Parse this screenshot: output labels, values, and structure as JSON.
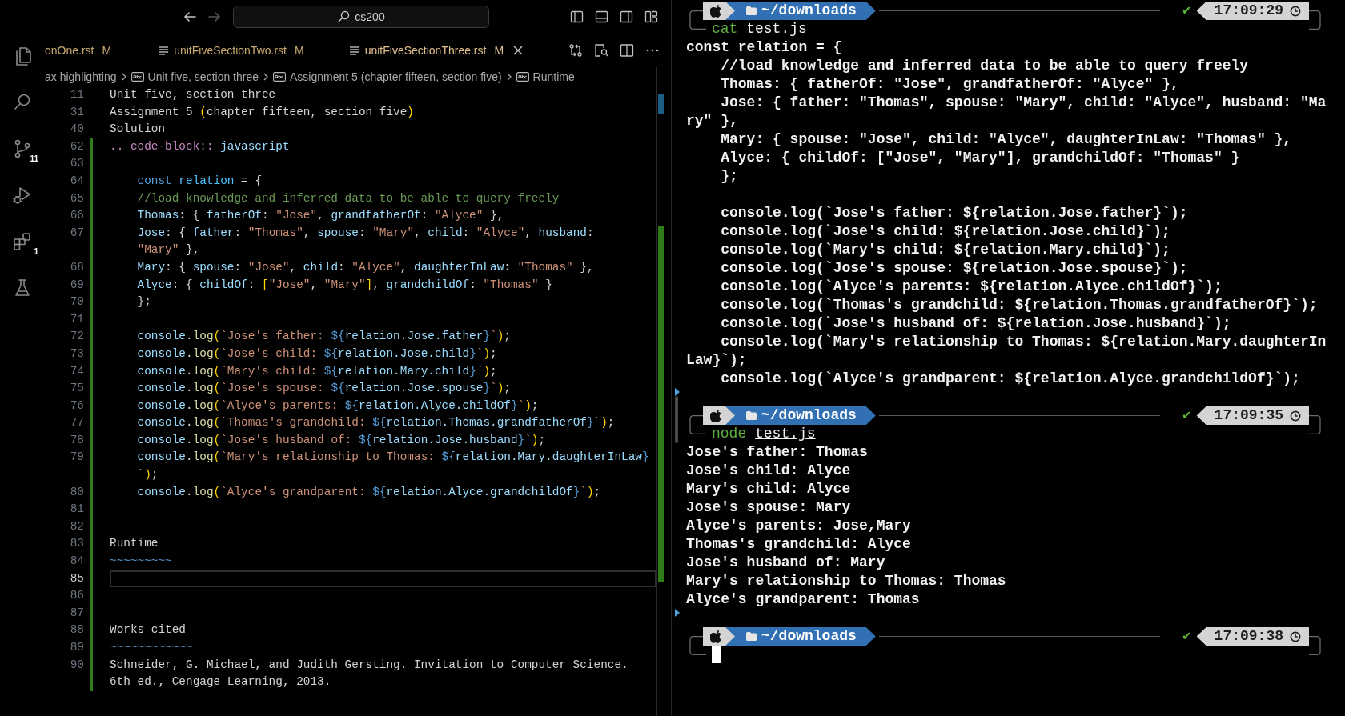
{
  "titlebar": {
    "back_disabled": false,
    "forward_disabled": true,
    "search": "cs200"
  },
  "activity_bar": [
    {
      "kind": "explorer"
    },
    {
      "kind": "search"
    },
    {
      "kind": "scm",
      "badge": "11"
    },
    {
      "kind": "debug"
    },
    {
      "kind": "extensions",
      "badge": "1"
    },
    {
      "kind": "testing"
    }
  ],
  "tabs": [
    {
      "label": "onOne.rst",
      "status": "M",
      "icon": false,
      "selected": false
    },
    {
      "label": "unitFiveSectionTwo.rst",
      "status": "M",
      "icon": true,
      "selected": false
    },
    {
      "label": "unitFiveSectionThree.rst",
      "status": "M",
      "icon": true,
      "selected": true
    }
  ],
  "breadcrumbs": [
    {
      "label": "ax highlighting",
      "icon": false
    },
    {
      "label": "Unit five, section three",
      "icon": true
    },
    {
      "label": "Assignment 5 (chapter fifteen, section five)",
      "icon": true
    },
    {
      "label": "Runtime",
      "icon": true
    }
  ],
  "editor": {
    "sticky": [
      {
        "number": "11",
        "tokens": [
          {
            "kind": "plain",
            "text": "Unit five, section three"
          }
        ]
      },
      {
        "number": "31",
        "tokens": [
          {
            "kind": "plain",
            "text": "Assignment 5 "
          },
          {
            "kind": "bracket",
            "text": "("
          },
          {
            "kind": "plain",
            "text": "chapter fifteen, section five"
          },
          {
            "kind": "bracket",
            "text": ")"
          }
        ]
      },
      {
        "number": "40",
        "tokens": [
          {
            "kind": "plain",
            "text": "Solution"
          }
        ]
      }
    ],
    "lines": [
      {
        "number": "62",
        "current": false,
        "tokens": [
          {
            "kind": "dir",
            "text": ".. code-block::"
          },
          {
            "kind": "var",
            "text": " javascript"
          }
        ]
      },
      {
        "number": "63",
        "current": false
      },
      {
        "number": "64",
        "current": false,
        "tokens": [
          {
            "kind": "kw",
            "text": "    const"
          },
          {
            "kind": "const",
            "text": " relation"
          },
          {
            "kind": "plain",
            "text": " = {"
          }
        ]
      },
      {
        "number": "65",
        "current": false,
        "tokens": [
          {
            "kind": "com",
            "text": "    //load knowledge and inferred data to be able to query freely"
          }
        ]
      },
      {
        "number": "66",
        "current": false,
        "tokens": [
          {
            "kind": "var",
            "text": "    Thomas"
          },
          {
            "kind": "plain",
            "text": ": { "
          },
          {
            "kind": "var",
            "text": "fatherOf"
          },
          {
            "kind": "plain",
            "text": ": "
          },
          {
            "kind": "str",
            "text": "\"Jose\""
          },
          {
            "kind": "plain",
            "text": ", "
          },
          {
            "kind": "var",
            "text": "grandfatherOf"
          },
          {
            "kind": "plain",
            "text": ": "
          },
          {
            "kind": "str",
            "text": "\"Alyce\""
          },
          {
            "kind": "plain",
            "text": " },"
          }
        ]
      },
      {
        "number": "67",
        "current": false,
        "tokens": [
          {
            "kind": "var",
            "text": "    Jose"
          },
          {
            "kind": "plain",
            "text": ": { "
          },
          {
            "kind": "var",
            "text": "father"
          },
          {
            "kind": "plain",
            "text": ": "
          },
          {
            "kind": "str",
            "text": "\"Thomas\""
          },
          {
            "kind": "plain",
            "text": ", "
          },
          {
            "kind": "var",
            "text": "spouse"
          },
          {
            "kind": "plain",
            "text": ": "
          },
          {
            "kind": "str",
            "text": "\"Mary\""
          },
          {
            "kind": "plain",
            "text": ", "
          },
          {
            "kind": "var",
            "text": "child"
          },
          {
            "kind": "plain",
            "text": ": "
          },
          {
            "kind": "str",
            "text": "\"Alyce\""
          },
          {
            "kind": "plain",
            "text": ", "
          },
          {
            "kind": "var",
            "text": "husband"
          },
          {
            "kind": "plain",
            "text": ":"
          }
        ]
      },
      {
        "current": false,
        "tokens": [
          {
            "kind": "str",
            "text": "    \"Mary\""
          },
          {
            "kind": "plain",
            "text": " },"
          }
        ]
      },
      {
        "number": "68",
        "current": false,
        "tokens": [
          {
            "kind": "var",
            "text": "    Mary"
          },
          {
            "kind": "plain",
            "text": ": { "
          },
          {
            "kind": "var",
            "text": "spouse"
          },
          {
            "kind": "plain",
            "text": ": "
          },
          {
            "kind": "str",
            "text": "\"Jose\""
          },
          {
            "kind": "plain",
            "text": ", "
          },
          {
            "kind": "var",
            "text": "child"
          },
          {
            "kind": "plain",
            "text": ": "
          },
          {
            "kind": "str",
            "text": "\"Alyce\""
          },
          {
            "kind": "plain",
            "text": ", "
          },
          {
            "kind": "var",
            "text": "daughterInLaw"
          },
          {
            "kind": "plain",
            "text": ": "
          },
          {
            "kind": "str",
            "text": "\"Thomas\""
          },
          {
            "kind": "plain",
            "text": " },"
          }
        ]
      },
      {
        "number": "69",
        "current": false,
        "tokens": [
          {
            "kind": "var",
            "text": "    Alyce"
          },
          {
            "kind": "plain",
            "text": ": { "
          },
          {
            "kind": "var",
            "text": "childOf"
          },
          {
            "kind": "plain",
            "text": ": "
          },
          {
            "kind": "bracket",
            "text": "["
          },
          {
            "kind": "str",
            "text": "\"Jose\""
          },
          {
            "kind": "plain",
            "text": ", "
          },
          {
            "kind": "str",
            "text": "\"Mary\""
          },
          {
            "kind": "bracket",
            "text": "]"
          },
          {
            "kind": "plain",
            "text": ", "
          },
          {
            "kind": "var",
            "text": "grandchildOf"
          },
          {
            "kind": "plain",
            "text": ": "
          },
          {
            "kind": "str",
            "text": "\"Thomas\""
          },
          {
            "kind": "plain",
            "text": " }"
          }
        ]
      },
      {
        "number": "70",
        "current": false,
        "tokens": [
          {
            "kind": "plain",
            "text": "    };"
          }
        ]
      },
      {
        "number": "71",
        "current": false
      },
      {
        "number": "72",
        "current": false,
        "tokens": [
          {
            "kind": "var",
            "text": "    console"
          },
          {
            "kind": "plain",
            "text": "."
          },
          {
            "kind": "fn",
            "text": "log"
          },
          {
            "kind": "bracket",
            "text": "("
          },
          {
            "kind": "str",
            "text": "`Jose's father: "
          },
          {
            "kind": "tpl",
            "text": "${"
          },
          {
            "kind": "var",
            "text": "relation.Jose.father"
          },
          {
            "kind": "tpl",
            "text": "}"
          },
          {
            "kind": "str",
            "text": "`"
          },
          {
            "kind": "bracket",
            "text": ")"
          },
          {
            "kind": "plain",
            "text": ";"
          }
        ]
      },
      {
        "number": "73",
        "current": false,
        "tokens": [
          {
            "kind": "var",
            "text": "    console"
          },
          {
            "kind": "plain",
            "text": "."
          },
          {
            "kind": "fn",
            "text": "log"
          },
          {
            "kind": "bracket",
            "text": "("
          },
          {
            "kind": "str",
            "text": "`Jose's child: "
          },
          {
            "kind": "tpl",
            "text": "${"
          },
          {
            "kind": "var",
            "text": "relation.Jose.child"
          },
          {
            "kind": "tpl",
            "text": "}"
          },
          {
            "kind": "str",
            "text": "`"
          },
          {
            "kind": "bracket",
            "text": ")"
          },
          {
            "kind": "plain",
            "text": ";"
          }
        ]
      },
      {
        "number": "74",
        "current": false,
        "tokens": [
          {
            "kind": "var",
            "text": "    console"
          },
          {
            "kind": "plain",
            "text": "."
          },
          {
            "kind": "fn",
            "text": "log"
          },
          {
            "kind": "bracket",
            "text": "("
          },
          {
            "kind": "str",
            "text": "`Mary's child: "
          },
          {
            "kind": "tpl",
            "text": "${"
          },
          {
            "kind": "var",
            "text": "relation.Mary.child"
          },
          {
            "kind": "tpl",
            "text": "}"
          },
          {
            "kind": "str",
            "text": "`"
          },
          {
            "kind": "bracket",
            "text": ")"
          },
          {
            "kind": "plain",
            "text": ";"
          }
        ]
      },
      {
        "number": "75",
        "current": false,
        "tokens": [
          {
            "kind": "var",
            "text": "    console"
          },
          {
            "kind": "plain",
            "text": "."
          },
          {
            "kind": "fn",
            "text": "log"
          },
          {
            "kind": "bracket",
            "text": "("
          },
          {
            "kind": "str",
            "text": "`Jose's spouse: "
          },
          {
            "kind": "tpl",
            "text": "${"
          },
          {
            "kind": "var",
            "text": "relation.Jose.spouse"
          },
          {
            "kind": "tpl",
            "text": "}"
          },
          {
            "kind": "str",
            "text": "`"
          },
          {
            "kind": "bracket",
            "text": ")"
          },
          {
            "kind": "plain",
            "text": ";"
          }
        ]
      },
      {
        "number": "76",
        "current": false,
        "tokens": [
          {
            "kind": "var",
            "text": "    console"
          },
          {
            "kind": "plain",
            "text": "."
          },
          {
            "kind": "fn",
            "text": "log"
          },
          {
            "kind": "bracket",
            "text": "("
          },
          {
            "kind": "str",
            "text": "`Alyce's parents: "
          },
          {
            "kind": "tpl",
            "text": "${"
          },
          {
            "kind": "var",
            "text": "relation.Alyce.childOf"
          },
          {
            "kind": "tpl",
            "text": "}"
          },
          {
            "kind": "str",
            "text": "`"
          },
          {
            "kind": "bracket",
            "text": ")"
          },
          {
            "kind": "plain",
            "text": ";"
          }
        ]
      },
      {
        "number": "77",
        "current": false,
        "tokens": [
          {
            "kind": "var",
            "text": "    console"
          },
          {
            "kind": "plain",
            "text": "."
          },
          {
            "kind": "fn",
            "text": "log"
          },
          {
            "kind": "bracket",
            "text": "("
          },
          {
            "kind": "str",
            "text": "`Thomas's grandchild: "
          },
          {
            "kind": "tpl",
            "text": "${"
          },
          {
            "kind": "var",
            "text": "relation.Thomas.grandfatherOf"
          },
          {
            "kind": "tpl",
            "text": "}"
          },
          {
            "kind": "str",
            "text": "`"
          },
          {
            "kind": "bracket",
            "text": ")"
          },
          {
            "kind": "plain",
            "text": ";"
          }
        ]
      },
      {
        "number": "78",
        "current": false,
        "tokens": [
          {
            "kind": "var",
            "text": "    console"
          },
          {
            "kind": "plain",
            "text": "."
          },
          {
            "kind": "fn",
            "text": "log"
          },
          {
            "kind": "bracket",
            "text": "("
          },
          {
            "kind": "str",
            "text": "`Jose's husband of: "
          },
          {
            "kind": "tpl",
            "text": "${"
          },
          {
            "kind": "var",
            "text": "relation.Jose.husband"
          },
          {
            "kind": "tpl",
            "text": "}"
          },
          {
            "kind": "str",
            "text": "`"
          },
          {
            "kind": "bracket",
            "text": ")"
          },
          {
            "kind": "plain",
            "text": ";"
          }
        ]
      },
      {
        "number": "79",
        "current": false,
        "tokens": [
          {
            "kind": "var",
            "text": "    console"
          },
          {
            "kind": "plain",
            "text": "."
          },
          {
            "kind": "fn",
            "text": "log"
          },
          {
            "kind": "bracket",
            "text": "("
          },
          {
            "kind": "str",
            "text": "`Mary's relationship to Thomas: "
          },
          {
            "kind": "tpl",
            "text": "${"
          },
          {
            "kind": "var",
            "text": "relation.Mary.daughterInLaw"
          },
          {
            "kind": "tpl",
            "text": "}"
          }
        ]
      },
      {
        "current": false,
        "tokens": [
          {
            "kind": "str",
            "text": "    `"
          },
          {
            "kind": "bracket",
            "text": ")"
          },
          {
            "kind": "plain",
            "text": ";"
          }
        ]
      },
      {
        "number": "80",
        "current": false,
        "tokens": [
          {
            "kind": "var",
            "text": "    console"
          },
          {
            "kind": "plain",
            "text": "."
          },
          {
            "kind": "fn",
            "text": "log"
          },
          {
            "kind": "bracket",
            "text": "("
          },
          {
            "kind": "str",
            "text": "`Alyce's grandparent: "
          },
          {
            "kind": "tpl",
            "text": "${"
          },
          {
            "kind": "var",
            "text": "relation.Alyce.grandchildOf"
          },
          {
            "kind": "tpl",
            "text": "}"
          },
          {
            "kind": "str",
            "text": "`"
          },
          {
            "kind": "bracket",
            "text": ")"
          },
          {
            "kind": "plain",
            "text": ";"
          }
        ]
      },
      {
        "number": "81",
        "current": false
      },
      {
        "number": "82",
        "current": false
      },
      {
        "number": "83",
        "current": false,
        "tokens": [
          {
            "kind": "plain",
            "text": "Runtime"
          }
        ]
      },
      {
        "number": "84",
        "current": false,
        "tokens": [
          {
            "kind": "tpl",
            "text": "~~~~~~~~~"
          }
        ]
      },
      {
        "number": "85",
        "current": true
      },
      {
        "number": "86",
        "current": false
      },
      {
        "number": "87",
        "current": false
      },
      {
        "number": "88",
        "current": false,
        "tokens": [
          {
            "kind": "plain",
            "text": "Works cited"
          }
        ]
      },
      {
        "number": "89",
        "current": false,
        "tokens": [
          {
            "kind": "tpl",
            "text": "~~~~~~~~~~~~"
          }
        ]
      },
      {
        "number": "90",
        "current": false,
        "tokens": [
          {
            "kind": "plain",
            "text": "Schneider, G. Michael, and Judith Gersting. Invitation to Computer Science."
          }
        ]
      },
      {
        "current": false,
        "tokens": [
          {
            "kind": "plain",
            "text": "6th ed., Cengage Learning, 2013."
          }
        ]
      }
    ]
  },
  "terminal": {
    "lines": [
      {
        "kind": "prompt",
        "dir": "~/downloads",
        "status": "✔",
        "time": "17:09:29"
      },
      {
        "kind": "command",
        "program": "cat",
        "args": "test.js"
      },
      {
        "kind": "output",
        "text": "const relation = {"
      },
      {
        "kind": "output",
        "text": "    //load knowledge and inferred data to be able to query freely"
      },
      {
        "kind": "output",
        "text": "    Thomas: { fatherOf: \"Jose\", grandfatherOf: \"Alyce\" },"
      },
      {
        "kind": "output",
        "text": "    Jose: { father: \"Thomas\", spouse: \"Mary\", child: \"Alyce\", husband: \"Ma"
      },
      {
        "kind": "output",
        "text": "ry\" },"
      },
      {
        "kind": "output",
        "text": "    Mary: { spouse: \"Jose\", child: \"Alyce\", daughterInLaw: \"Thomas\" },"
      },
      {
        "kind": "output",
        "text": "    Alyce: { childOf: [\"Jose\", \"Mary\"], grandchildOf: \"Thomas\" }"
      },
      {
        "kind": "output",
        "text": "    };"
      },
      {
        "kind": "blank"
      },
      {
        "kind": "output",
        "text": "    console.log(`Jose's father: ${relation.Jose.father}`);"
      },
      {
        "kind": "output",
        "text": "    console.log(`Jose's child: ${relation.Jose.child}`);"
      },
      {
        "kind": "output",
        "text": "    console.log(`Mary's child: ${relation.Mary.child}`);"
      },
      {
        "kind": "output",
        "text": "    console.log(`Jose's spouse: ${relation.Jose.spouse}`);"
      },
      {
        "kind": "output",
        "text": "    console.log(`Alyce's parents: ${relation.Alyce.childOf}`);"
      },
      {
        "kind": "output",
        "text": "    console.log(`Thomas's grandchild: ${relation.Thomas.grandfatherOf}`);"
      },
      {
        "kind": "output",
        "text": "    console.log(`Jose's husband of: ${relation.Jose.husband}`);"
      },
      {
        "kind": "output",
        "text": "    console.log(`Mary's relationship to Thomas: ${relation.Mary.daughterIn"
      },
      {
        "kind": "output",
        "text": "Law}`);"
      },
      {
        "kind": "output",
        "text": "    console.log(`Alyce's grandparent: ${relation.Alyce.grandchildOf}`);"
      },
      {
        "kind": "marker"
      },
      {
        "kind": "prompt",
        "dir": "~/downloads",
        "status": "✔",
        "time": "17:09:35"
      },
      {
        "kind": "command",
        "program": "node",
        "args": "test.js"
      },
      {
        "kind": "output",
        "text": "Jose's father: Thomas"
      },
      {
        "kind": "output",
        "text": "Jose's child: Alyce"
      },
      {
        "kind": "output",
        "text": "Mary's child: Alyce"
      },
      {
        "kind": "output",
        "text": "Jose's spouse: Mary"
      },
      {
        "kind": "output",
        "text": "Alyce's parents: Jose,Mary"
      },
      {
        "kind": "output",
        "text": "Thomas's grandchild: Alyce"
      },
      {
        "kind": "output",
        "text": "Jose's husband of: Mary"
      },
      {
        "kind": "output",
        "text": "Mary's relationship to Thomas: Thomas"
      },
      {
        "kind": "output",
        "text": "Alyce's grandparent: Thomas"
      },
      {
        "kind": "marker"
      },
      {
        "kind": "prompt",
        "dir": "~/downloads",
        "status": "✔",
        "time": "17:09:38"
      },
      {
        "kind": "cursor"
      }
    ]
  }
}
